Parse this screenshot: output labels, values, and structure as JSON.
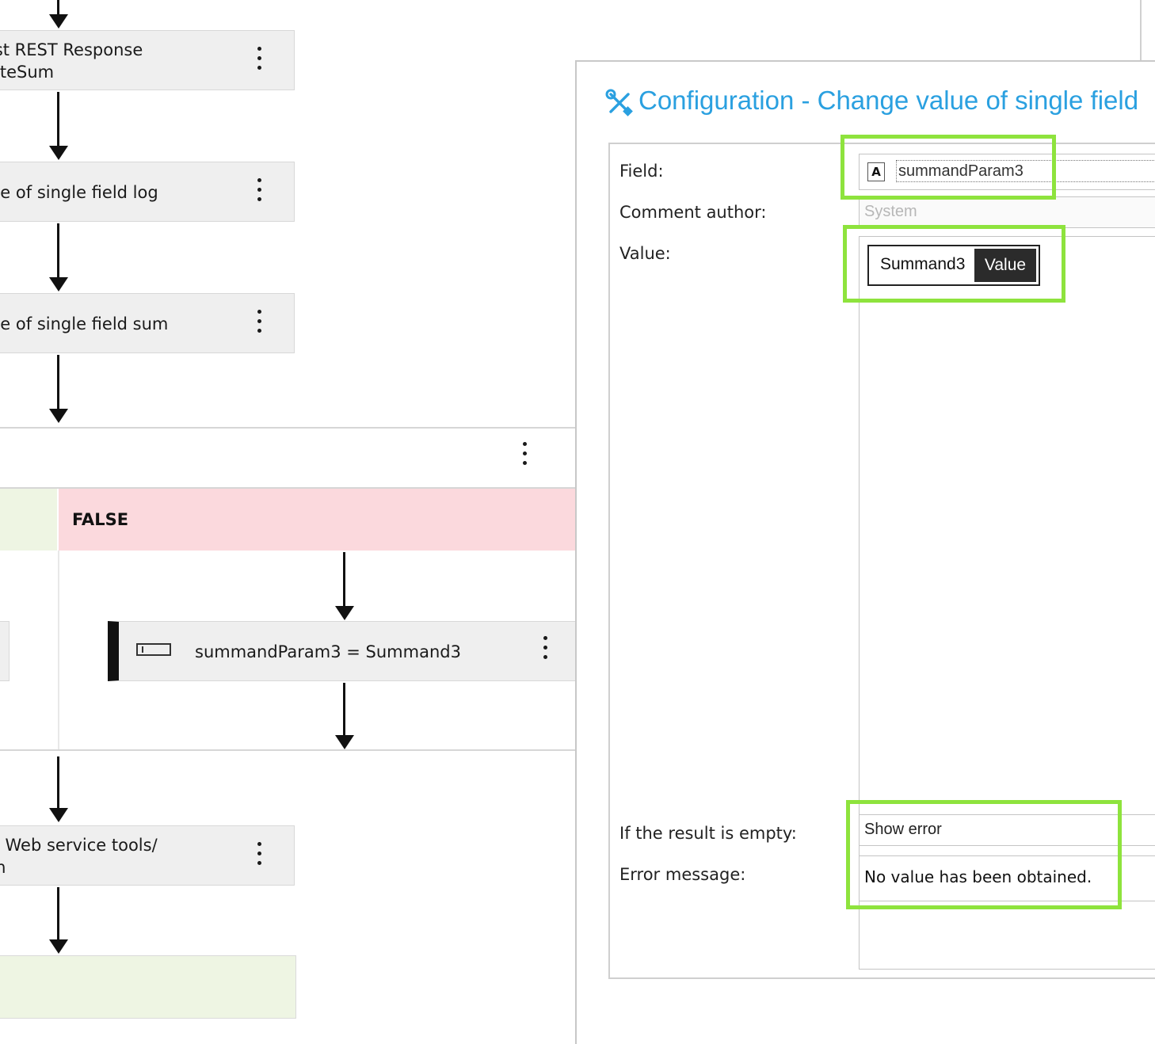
{
  "workflow": {
    "steps": [
      {
        "line1": "ist REST Response",
        "line2": "ateSum"
      },
      {
        "line1": "ue of single field log",
        "line2": ""
      },
      {
        "line1": "ue of single field sum",
        "line2": ""
      }
    ],
    "branch": {
      "false_label": "FALSE",
      "false_step": "summandParam3 = Summand3"
    },
    "after_steps": [
      {
        "line1": "T Web service tools/",
        "line2": "m"
      }
    ]
  },
  "dialog": {
    "title": "Configuration - Change value of single field",
    "labels": {
      "field": "Field:",
      "comment_author": "Comment author:",
      "value": "Value:",
      "if_empty": "If the result is empty:",
      "error_message": "Error message:"
    },
    "field_type_badge": "A",
    "field_value": "summandParam3",
    "comment_author_placeholder": "System",
    "value_token": {
      "name": "Summand3",
      "kind": "Value"
    },
    "if_empty_value": "Show error",
    "error_message_value": "No value has been obtained."
  },
  "colors": {
    "accent": "#2aa0e0",
    "highlight": "#8ee33d",
    "false_branch": "#fbd9dd",
    "true_branch": "#eef5e3"
  }
}
